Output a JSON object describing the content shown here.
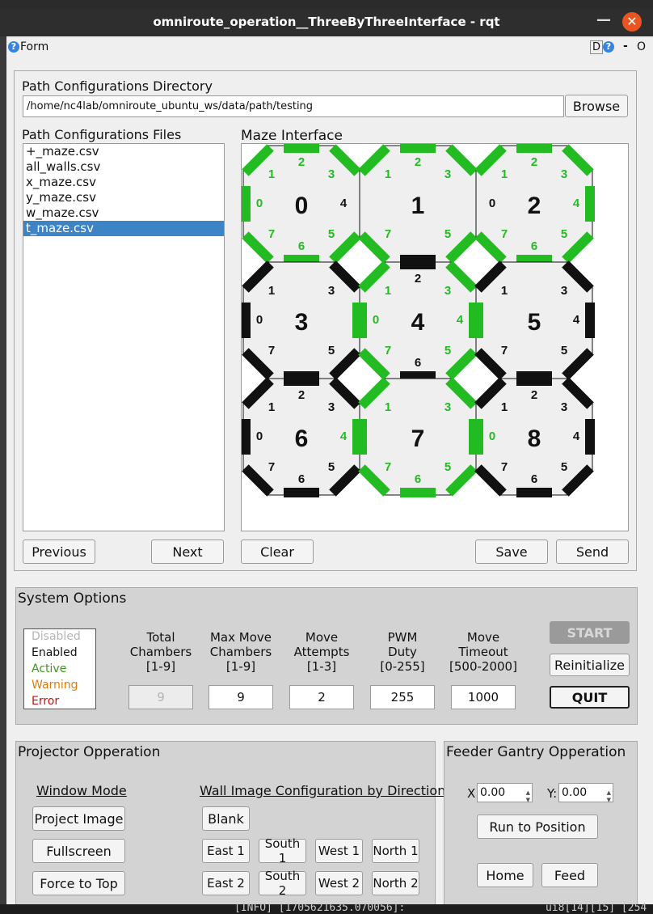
{
  "window": {
    "title": "omniroute_operation__ThreeByThreeInterface - rqt",
    "form_label": "Form",
    "d_label": "D",
    "dash_label": "-",
    "o_label": "O"
  },
  "path_config": {
    "dir_label": "Path Configurations Directory",
    "dir_value": "/home/nc4lab/omniroute_ubuntu_ws/data/path/testing",
    "browse_label": "Browse",
    "files_label": "Path Configurations Files",
    "files": [
      "+_maze.csv",
      "all_walls.csv",
      "x_maze.csv",
      "y_maze.csv",
      "w_maze.csv",
      "t_maze.csv"
    ],
    "selected_index": 5,
    "previous_label": "Previous",
    "next_label": "Next"
  },
  "maze": {
    "title": "Maze Interface",
    "clear_label": "Clear",
    "save_label": "Save",
    "send_label": "Send",
    "colors": {
      "active": "#22bb22",
      "wall": "#111111",
      "fill": "#efefef"
    },
    "chambers": [
      {
        "id": "0",
        "walls": [
          0,
          1,
          2,
          3,
          5,
          6,
          7
        ],
        "active_walls": [
          0,
          1,
          2,
          3,
          5,
          6,
          7
        ],
        "labels": {
          "0": "0",
          "1": "1",
          "2": "2",
          "3": "3",
          "4": "4",
          "5": "5",
          "6": "6",
          "7": "7"
        },
        "green_labels": [
          0,
          1,
          2,
          3,
          5,
          6,
          7
        ]
      },
      {
        "id": "1",
        "walls": [
          1,
          2,
          3,
          5,
          6,
          7
        ],
        "active_walls": [
          1,
          2,
          3,
          5,
          7
        ],
        "labels": {
          "1": "1",
          "2": "2",
          "3": "3",
          "5": "5",
          "7": "7"
        },
        "green_labels": [
          1,
          2,
          3,
          5,
          7
        ]
      },
      {
        "id": "2",
        "walls": [
          1,
          2,
          3,
          4,
          5,
          6,
          7
        ],
        "active_walls": [
          1,
          2,
          3,
          4,
          5,
          6,
          7
        ],
        "labels": {
          "0": "0",
          "1": "1",
          "2": "2",
          "3": "3",
          "4": "4",
          "5": "5",
          "6": "6",
          "7": "7"
        },
        "green_labels": [
          1,
          2,
          3,
          4,
          5,
          6,
          7
        ]
      },
      {
        "id": "3",
        "walls": [
          0,
          1,
          3,
          4,
          5,
          6,
          7
        ],
        "active_walls": [
          4
        ],
        "labels": {
          "0": "0",
          "1": "1",
          "3": "3",
          "5": "5",
          "7": "7"
        },
        "green_labels": []
      },
      {
        "id": "4",
        "walls": [
          0,
          1,
          2,
          3,
          4,
          5,
          6,
          7
        ],
        "active_walls": [
          0,
          1,
          3,
          4,
          5,
          7
        ],
        "labels": {
          "0": "0",
          "1": "1",
          "2": "2",
          "3": "3",
          "4": "4",
          "5": "5",
          "6": "6",
          "7": "7"
        },
        "green_labels": [
          0,
          1,
          3,
          4,
          5,
          7
        ]
      },
      {
        "id": "5",
        "walls": [
          0,
          1,
          3,
          4,
          5,
          6,
          7
        ],
        "active_walls": [
          0
        ],
        "labels": {
          "1": "1",
          "3": "3",
          "4": "4",
          "5": "5",
          "7": "7"
        },
        "green_labels": []
      },
      {
        "id": "6",
        "walls": [
          0,
          1,
          2,
          3,
          4,
          5,
          6,
          7
        ],
        "active_walls": [
          4
        ],
        "labels": {
          "0": "0",
          "1": "1",
          "2": "2",
          "3": "3",
          "4": "4",
          "5": "5",
          "6": "6",
          "7": "7"
        },
        "green_labels": [
          4
        ]
      },
      {
        "id": "7",
        "walls": [
          0,
          1,
          3,
          4,
          5,
          6,
          7
        ],
        "active_walls": [
          0,
          1,
          3,
          4,
          5,
          6,
          7
        ],
        "labels": {
          "1": "1",
          "3": "3",
          "5": "5",
          "6": "6",
          "7": "7"
        },
        "green_labels": [
          1,
          3,
          5,
          6,
          7
        ]
      },
      {
        "id": "8",
        "walls": [
          0,
          1,
          2,
          3,
          4,
          5,
          6,
          7
        ],
        "active_walls": [
          0
        ],
        "labels": {
          "0": "0",
          "1": "1",
          "2": "2",
          "3": "3",
          "4": "4",
          "5": "5",
          "6": "6",
          "7": "7"
        },
        "green_labels": [
          0
        ]
      }
    ]
  },
  "system": {
    "title": "System Options",
    "legend": [
      {
        "label": "Disabled",
        "color": "#b5b5b5"
      },
      {
        "label": "Enabled",
        "color": "#111111"
      },
      {
        "label": "Active",
        "color": "#3a9a1a"
      },
      {
        "label": "Warning",
        "color": "#e07b10"
      },
      {
        "label": "Error",
        "color": "#c81010"
      }
    ],
    "params": [
      {
        "l1": "Total",
        "l2": "Chambers",
        "l3": "[1-9]",
        "value": "9",
        "disabled": true
      },
      {
        "l1": "Max Move",
        "l2": "Chambers",
        "l3": "[1-9]",
        "value": "9",
        "disabled": false
      },
      {
        "l1": "Move",
        "l2": "Attempts",
        "l3": "[1-3]",
        "value": "2",
        "disabled": false
      },
      {
        "l1": "PWM",
        "l2": "Duty",
        "l3": "[0-255]",
        "value": "255",
        "disabled": false
      },
      {
        "l1": "Move",
        "l2": "Timeout",
        "l3": "[500-2000]",
        "value": "1000",
        "disabled": false
      }
    ],
    "start_label": "START",
    "reinit_label": "Reinitialize",
    "quit_label": "QUIT"
  },
  "projector": {
    "title": "Projector Opperation",
    "window_mode_label": "Window Mode",
    "wall_config_label": "Wall Image Configuration by Direction",
    "project_image_label": "Project Image",
    "fullscreen_label": "Fullscreen",
    "force_top_label": "Force to Top",
    "blank_label": "Blank",
    "row1": [
      "East 1",
      "South 1",
      "West 1",
      "North 1"
    ],
    "row2": [
      "East 2",
      "South 2",
      "West 2",
      "North 2"
    ]
  },
  "feeder": {
    "title": "Feeder Gantry Opperation",
    "x_label": "X:",
    "x_value": "0.00",
    "y_label": "Y:",
    "y_value": "0.00",
    "run_label": "Run to Position",
    "home_label": "Home",
    "feed_label": "Feed"
  },
  "terminal": {
    "line_left": "[INFO] [1705621635.070056]:",
    "line_right": "ui8[14][15] [254"
  }
}
